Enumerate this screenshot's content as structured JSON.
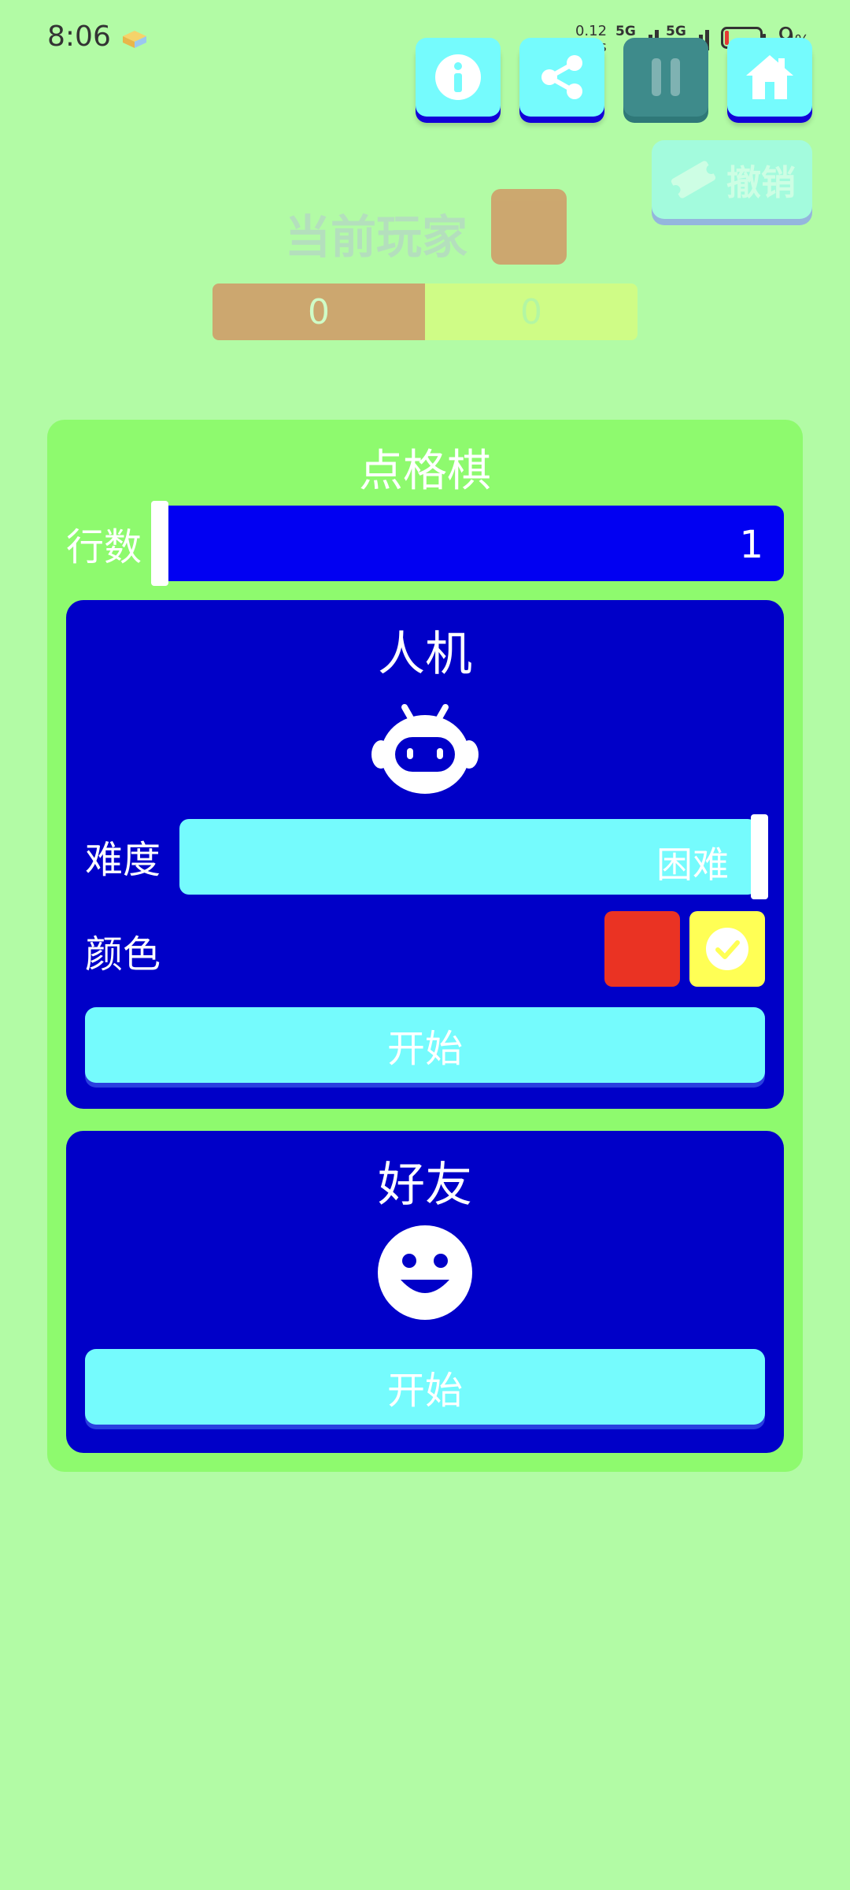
{
  "status_bar": {
    "time": "8:06",
    "net_speed_value": "0.12",
    "net_speed_unit": "KB/s",
    "signal1": "5G",
    "signal2": "5G",
    "battery_value": "9",
    "battery_unit": "%"
  },
  "toolbar": {
    "info_icon": "info-icon",
    "share_icon": "share-icon",
    "pause_icon": "pause-icon",
    "home_icon": "home-icon",
    "undo_label": "撤销"
  },
  "player": {
    "label": "当前玩家",
    "current_color": "#f82118",
    "score_red": "0",
    "score_yellow": "0"
  },
  "panel": {
    "title": "点格棋",
    "rows_label": "行数",
    "rows_value": "1"
  },
  "ai_mode": {
    "title": "人机",
    "icon": "robot-icon",
    "difficulty_label": "难度",
    "difficulty_value": "困难",
    "color_label": "颜色",
    "color_options": [
      "#ea3323",
      "#ffff55"
    ],
    "selected_color": "#ffff55",
    "start_label": "开始"
  },
  "friend_mode": {
    "title": "好友",
    "icon": "smiley-icon",
    "start_label": "开始"
  },
  "colors": {
    "background": "#b2fba5",
    "panel": "#8efa6e",
    "card": "#0000c8",
    "accent": "#75fbfd"
  }
}
